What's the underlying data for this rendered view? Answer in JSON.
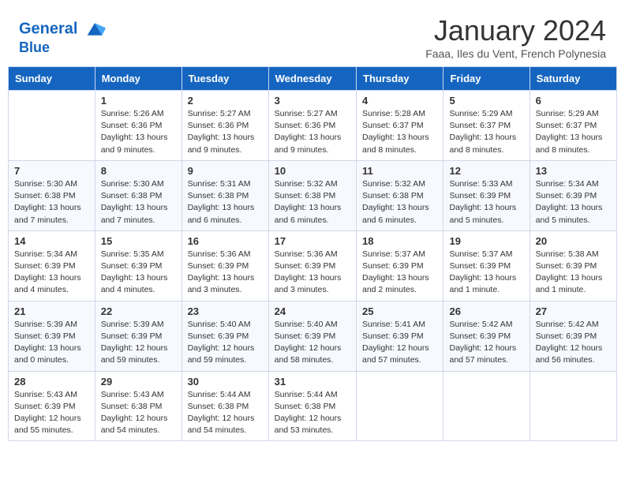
{
  "header": {
    "logo_line1": "General",
    "logo_line2": "Blue",
    "month_title": "January 2024",
    "subtitle": "Faaa, Iles du Vent, French Polynesia"
  },
  "weekdays": [
    "Sunday",
    "Monday",
    "Tuesday",
    "Wednesday",
    "Thursday",
    "Friday",
    "Saturday"
  ],
  "weeks": [
    [
      {
        "day": "",
        "info": ""
      },
      {
        "day": "1",
        "info": "Sunrise: 5:26 AM\nSunset: 6:36 PM\nDaylight: 13 hours\nand 9 minutes."
      },
      {
        "day": "2",
        "info": "Sunrise: 5:27 AM\nSunset: 6:36 PM\nDaylight: 13 hours\nand 9 minutes."
      },
      {
        "day": "3",
        "info": "Sunrise: 5:27 AM\nSunset: 6:36 PM\nDaylight: 13 hours\nand 9 minutes."
      },
      {
        "day": "4",
        "info": "Sunrise: 5:28 AM\nSunset: 6:37 PM\nDaylight: 13 hours\nand 8 minutes."
      },
      {
        "day": "5",
        "info": "Sunrise: 5:29 AM\nSunset: 6:37 PM\nDaylight: 13 hours\nand 8 minutes."
      },
      {
        "day": "6",
        "info": "Sunrise: 5:29 AM\nSunset: 6:37 PM\nDaylight: 13 hours\nand 8 minutes."
      }
    ],
    [
      {
        "day": "7",
        "info": "Sunrise: 5:30 AM\nSunset: 6:38 PM\nDaylight: 13 hours\nand 7 minutes."
      },
      {
        "day": "8",
        "info": "Sunrise: 5:30 AM\nSunset: 6:38 PM\nDaylight: 13 hours\nand 7 minutes."
      },
      {
        "day": "9",
        "info": "Sunrise: 5:31 AM\nSunset: 6:38 PM\nDaylight: 13 hours\nand 6 minutes."
      },
      {
        "day": "10",
        "info": "Sunrise: 5:32 AM\nSunset: 6:38 PM\nDaylight: 13 hours\nand 6 minutes."
      },
      {
        "day": "11",
        "info": "Sunrise: 5:32 AM\nSunset: 6:38 PM\nDaylight: 13 hours\nand 6 minutes."
      },
      {
        "day": "12",
        "info": "Sunrise: 5:33 AM\nSunset: 6:39 PM\nDaylight: 13 hours\nand 5 minutes."
      },
      {
        "day": "13",
        "info": "Sunrise: 5:34 AM\nSunset: 6:39 PM\nDaylight: 13 hours\nand 5 minutes."
      }
    ],
    [
      {
        "day": "14",
        "info": "Sunrise: 5:34 AM\nSunset: 6:39 PM\nDaylight: 13 hours\nand 4 minutes."
      },
      {
        "day": "15",
        "info": "Sunrise: 5:35 AM\nSunset: 6:39 PM\nDaylight: 13 hours\nand 4 minutes."
      },
      {
        "day": "16",
        "info": "Sunrise: 5:36 AM\nSunset: 6:39 PM\nDaylight: 13 hours\nand 3 minutes."
      },
      {
        "day": "17",
        "info": "Sunrise: 5:36 AM\nSunset: 6:39 PM\nDaylight: 13 hours\nand 3 minutes."
      },
      {
        "day": "18",
        "info": "Sunrise: 5:37 AM\nSunset: 6:39 PM\nDaylight: 13 hours\nand 2 minutes."
      },
      {
        "day": "19",
        "info": "Sunrise: 5:37 AM\nSunset: 6:39 PM\nDaylight: 13 hours\nand 1 minute."
      },
      {
        "day": "20",
        "info": "Sunrise: 5:38 AM\nSunset: 6:39 PM\nDaylight: 13 hours\nand 1 minute."
      }
    ],
    [
      {
        "day": "21",
        "info": "Sunrise: 5:39 AM\nSunset: 6:39 PM\nDaylight: 13 hours\nand 0 minutes."
      },
      {
        "day": "22",
        "info": "Sunrise: 5:39 AM\nSunset: 6:39 PM\nDaylight: 12 hours\nand 59 minutes."
      },
      {
        "day": "23",
        "info": "Sunrise: 5:40 AM\nSunset: 6:39 PM\nDaylight: 12 hours\nand 59 minutes."
      },
      {
        "day": "24",
        "info": "Sunrise: 5:40 AM\nSunset: 6:39 PM\nDaylight: 12 hours\nand 58 minutes."
      },
      {
        "day": "25",
        "info": "Sunrise: 5:41 AM\nSunset: 6:39 PM\nDaylight: 12 hours\nand 57 minutes."
      },
      {
        "day": "26",
        "info": "Sunrise: 5:42 AM\nSunset: 6:39 PM\nDaylight: 12 hours\nand 57 minutes."
      },
      {
        "day": "27",
        "info": "Sunrise: 5:42 AM\nSunset: 6:39 PM\nDaylight: 12 hours\nand 56 minutes."
      }
    ],
    [
      {
        "day": "28",
        "info": "Sunrise: 5:43 AM\nSunset: 6:39 PM\nDaylight: 12 hours\nand 55 minutes."
      },
      {
        "day": "29",
        "info": "Sunrise: 5:43 AM\nSunset: 6:38 PM\nDaylight: 12 hours\nand 54 minutes."
      },
      {
        "day": "30",
        "info": "Sunrise: 5:44 AM\nSunset: 6:38 PM\nDaylight: 12 hours\nand 54 minutes."
      },
      {
        "day": "31",
        "info": "Sunrise: 5:44 AM\nSunset: 6:38 PM\nDaylight: 12 hours\nand 53 minutes."
      },
      {
        "day": "",
        "info": ""
      },
      {
        "day": "",
        "info": ""
      },
      {
        "day": "",
        "info": ""
      }
    ]
  ]
}
